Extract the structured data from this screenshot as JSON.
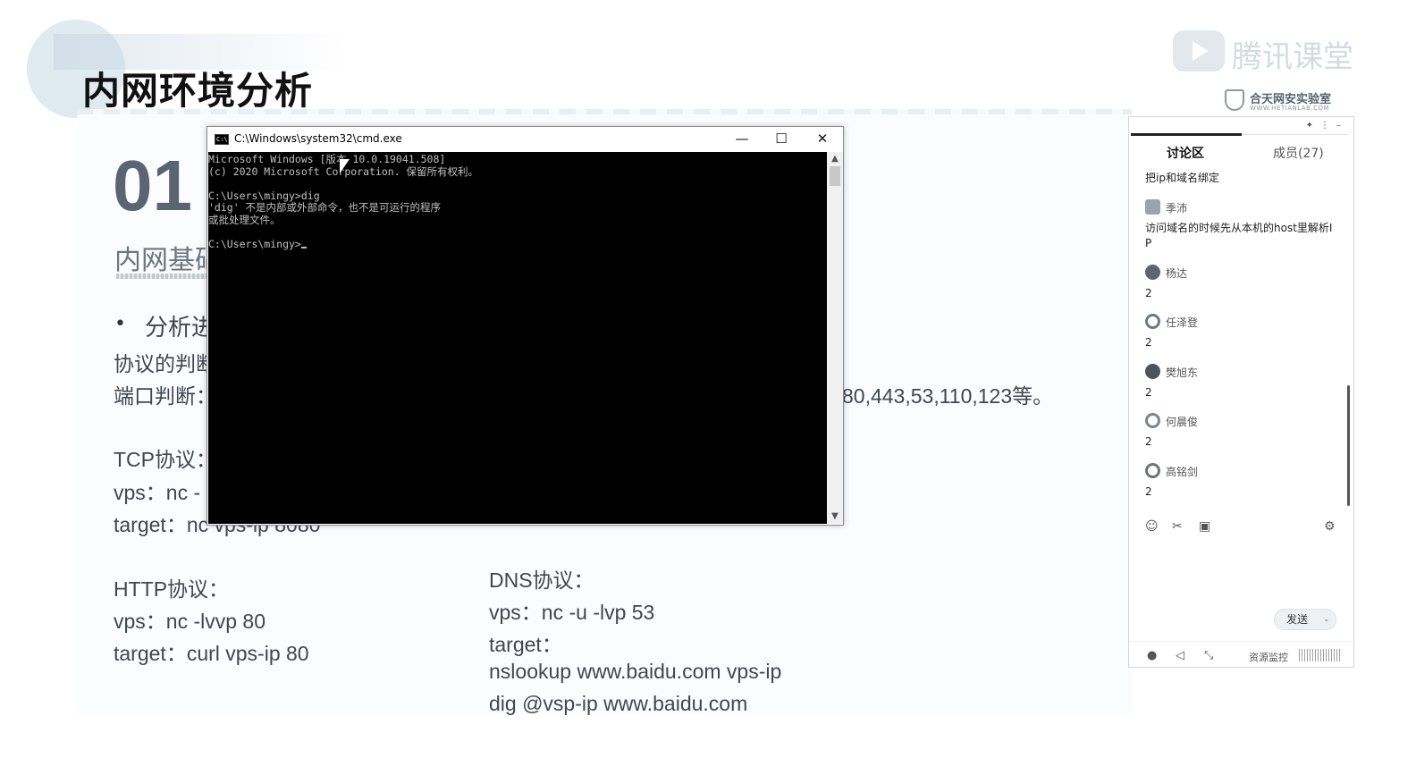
{
  "slide": {
    "title": "内网环境分析",
    "section_number": "01",
    "section_subtitle": "内网基础",
    "bullet_text": "分析进",
    "protocol_judge": "协议的判断",
    "port_judge": "端口判断：",
    "port_list": "80,443,53,110,123等。",
    "tcp_label": "TCP协议：",
    "tcp_vps": "vps：nc -",
    "tcp_target": "target：nc vps-ip 8080",
    "http_label": "HTTP协议：",
    "http_vps": "vps：nc -lvvp 80",
    "http_target": "target：curl vps-ip 80",
    "dns_label": "DNS协议：",
    "dns_vps": "vps：nc -u -lvp 53",
    "dns_target": "target：",
    "dns_cmd1": "nslookup www.baidu.com vps-ip",
    "dns_cmd2": "dig @vsp-ip www.baidu.com"
  },
  "brand": {
    "tencent_class": "腾讯课堂",
    "lab_name": "合天网安实验室",
    "lab_url": "WWW.HETIANLAB.COM"
  },
  "cmd_window": {
    "title": "C:\\Windows\\system32\\cmd.exe",
    "app_icon": "cmd-icon",
    "minimize_icon": "—",
    "maximize_icon": "☐",
    "close_icon": "✕",
    "lines": [
      "Microsoft Windows [版本 10.0.19041.508]",
      "(c) 2020 Microsoft Corporation. 保留所有权利。",
      "",
      "C:\\Users\\mingy>dig",
      "'dig' 不是内部或外部命令，也不是可运行的程序",
      "或批处理文件。",
      "",
      "C:\\Users\\mingy>"
    ]
  },
  "discussion_panel": {
    "tabs": [
      {
        "label": "讨论区",
        "active": true
      },
      {
        "label": "成员(27)",
        "active": false
      }
    ],
    "top_icons": [
      "pin-icon",
      "more-icon",
      "minimize-icon"
    ],
    "messages": [
      {
        "user": "",
        "text": "把ip和域名绑定"
      },
      {
        "user": "季沛",
        "text": "访问域名的时候先从本机的host里解析IP"
      },
      {
        "user": "杨达",
        "text": "2"
      },
      {
        "user": "任泽登",
        "text": "2"
      },
      {
        "user": "樊旭东",
        "text": "2"
      },
      {
        "user": "何晨俊",
        "text": "2"
      },
      {
        "user": "高铭剑",
        "text": "2"
      }
    ],
    "toolbar_icons": [
      "emoji-icon",
      "scissors-icon",
      "image-icon",
      "settings-icon"
    ],
    "send_label": "发送",
    "bottom_icons": [
      "microphone-icon",
      "speaker-icon",
      "mute-icon"
    ],
    "resource_monitor_label": "资源监控"
  },
  "colors": {
    "accent_dark": "#111111",
    "slide_text": "#3f4750",
    "cmd_bg": "#000000",
    "cmd_text": "#c0c0c0"
  }
}
